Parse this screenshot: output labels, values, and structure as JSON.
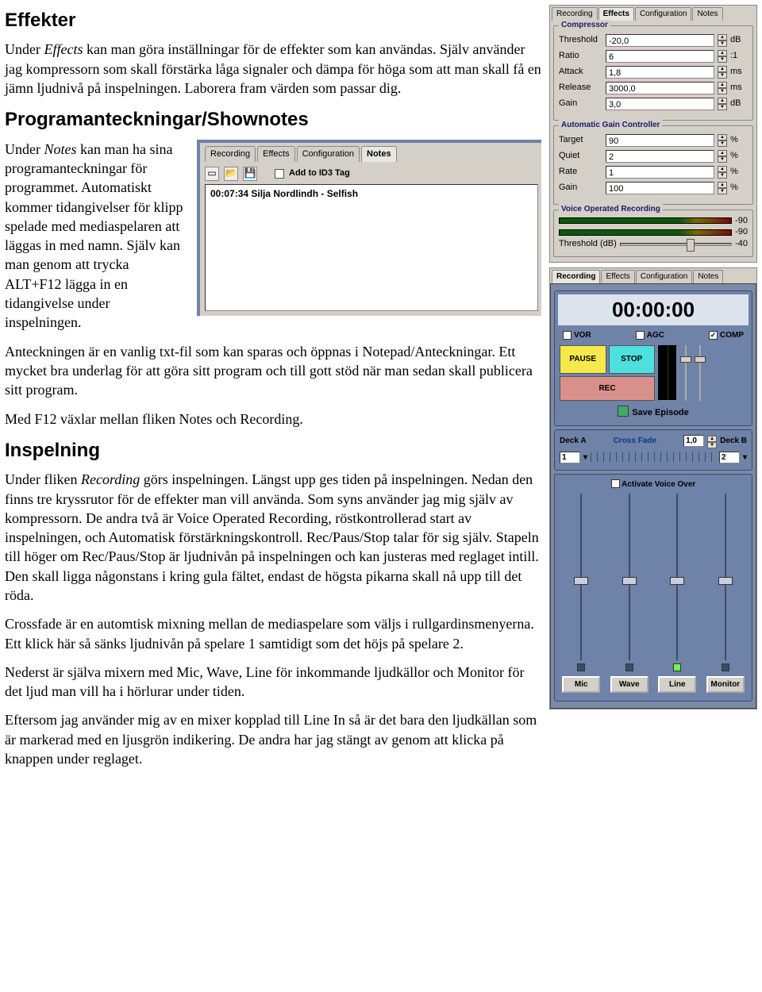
{
  "article": {
    "h1": "Effekter",
    "p1a": "Under ",
    "p1b": "Effects",
    "p1c": " kan man göra inställningar för de effekter som kan användas. Själv använder jag kompressorn som skall förstärka låga signaler och dämpa för höga som att man skall få en jämn ljudnivå på inspelningen. Laborera fram värden som passar dig.",
    "h2": "Programanteckningar/Shownotes",
    "p2a": "Under ",
    "p2b": "Notes",
    "p2c": " kan man ha sina programanteckningar för programmet. Automatiskt kommer tidangivelser för klipp spelade med mediaspelaren att läggas in med namn. Själv kan man genom att trycka ALT+F12 lägga in en tidangivelse under inspelningen.",
    "p3": "Anteckningen är en vanlig txt-fil som kan sparas och öppnas i Notepad/Anteckningar. Ett mycket bra underlag för att göra sitt program och till gott stöd när man sedan skall publicera sitt program.",
    "p4": "Med F12 växlar mellan fliken Notes och Recording.",
    "h3": "Inspelning",
    "p5a": "Under fliken ",
    "p5b": "Recording",
    "p5c": " görs inspelningen. Längst upp ges tiden på inspelningen. Nedan den finns tre kryssrutor för de effekter man vill använda. Som syns använder jag mig själv av kompressorn. De andra två är Voice Operated Recording, röstkontrollerad start av inspelningen, och Automatisk förstärkningskontroll. Rec/Paus/Stop talar för sig själv. Stapeln till höger om Rec/Paus/Stop är ljudnivån på inspelningen och kan justeras med reglaget intill. Den skall ligga någonstans i kring gula fältet, endast de högsta pikarna skall nå upp till det röda.",
    "p6": "Crossfade är en automtisk mixning mellan de mediaspelare som väljs i rullgardinsmenyerna. Ett klick här så sänks ljudnivån på spelare 1 samtidigt som det höjs på spelare 2.",
    "p7": "Nederst är själva mixern med Mic, Wave, Line för inkommande ljudkällor och Monitor för det ljud man vill ha i hörlurar under tiden.",
    "p8": "Eftersom jag använder mig av en mixer  kopplad till Line In så är det bara den ljudkällan som är markerad med en ljusgrön indikering. De andra har jag stängt av genom att klicka på knappen under reglaget."
  },
  "notes_panel": {
    "tabs": [
      "Recording",
      "Effects",
      "Configuration",
      "Notes"
    ],
    "active_tab": "Notes",
    "add_to_id3": "Add to ID3 Tag",
    "content": "00:07:34 Silja Nordlindh - Selfish"
  },
  "effects_panel": {
    "tabs": [
      "Recording",
      "Effects",
      "Configuration",
      "Notes"
    ],
    "active_tab": "Effects",
    "compressor": {
      "title": "Compressor",
      "rows": [
        {
          "label": "Threshold",
          "value": "-20,0",
          "unit": "dB"
        },
        {
          "label": "Ratio",
          "value": "6",
          "unit": ":1"
        },
        {
          "label": "Attack",
          "value": "1,8",
          "unit": "ms"
        },
        {
          "label": "Release",
          "value": "3000,0",
          "unit": "ms"
        },
        {
          "label": "Gain",
          "value": "3,0",
          "unit": "dB"
        }
      ]
    },
    "agc": {
      "title": "Automatic Gain Controller",
      "rows": [
        {
          "label": "Target",
          "value": "90",
          "unit": "%"
        },
        {
          "label": "Quiet",
          "value": "2",
          "unit": "%"
        },
        {
          "label": "Rate",
          "value": "1",
          "unit": "%"
        },
        {
          "label": "Gain",
          "value": "100",
          "unit": "%"
        }
      ]
    },
    "vor": {
      "title": "Voice Operated Recording",
      "right_vals": [
        "-90",
        "-90",
        "-40"
      ],
      "threshold_label": "Threshold (dB)"
    }
  },
  "recording_panel": {
    "tabs": [
      "Recording",
      "Effects",
      "Configuration",
      "Notes"
    ],
    "active_tab": "Recording",
    "timer": "00:00:00",
    "checks": {
      "vor": "VOR",
      "agc": "AGC",
      "comp": "COMP"
    },
    "comp_checked": "✓",
    "btn_pause": "PAUSE",
    "btn_stop": "STOP",
    "btn_rec": "REC",
    "save": "Save Episode",
    "deck_a": "Deck A",
    "deck_b": "Deck B",
    "crossfade": "Cross Fade",
    "cf_value": "1,0",
    "deck_a_sel": "1",
    "deck_b_sel": "2",
    "activate_vo": "Activate Voice Over",
    "mixer": [
      "Mic",
      "Wave",
      "Line",
      "Monitor"
    ]
  }
}
